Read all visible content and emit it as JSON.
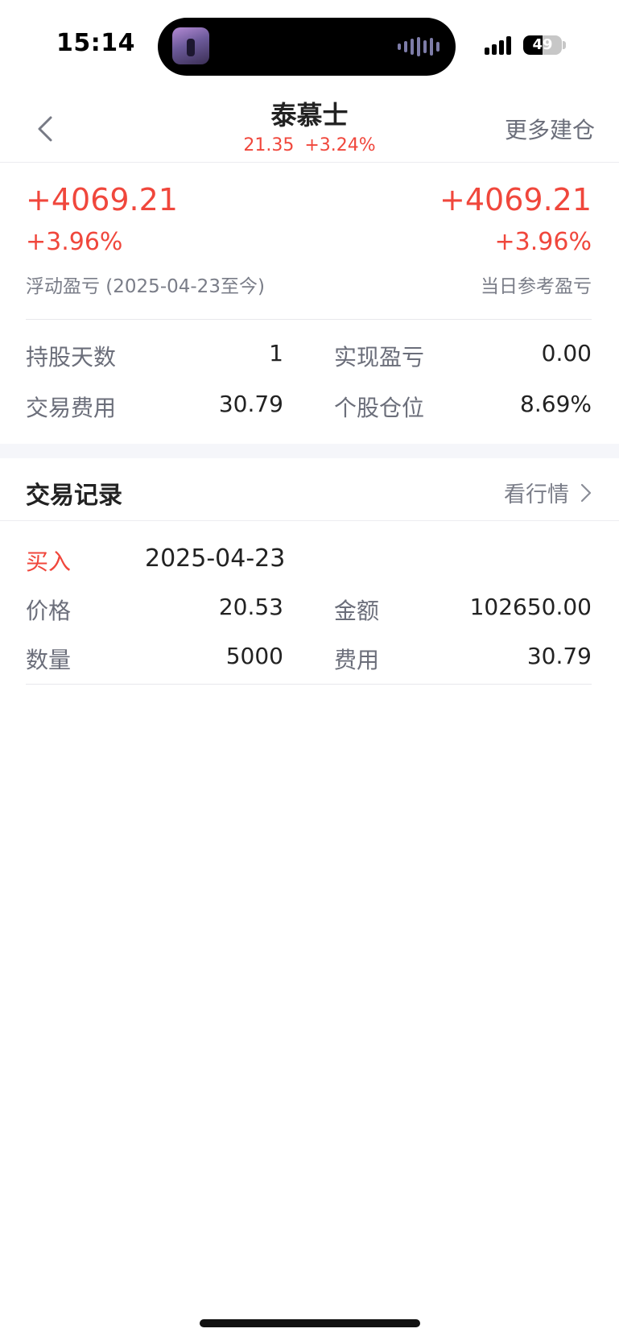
{
  "status_bar": {
    "time": "15:14",
    "battery": "49",
    "battery_level": 0.49,
    "island_icon": "music-artwork-thumbnail",
    "island_activity_icon": "audio-waveform-icon"
  },
  "nav": {
    "back_icon": "chevron-left-icon",
    "title": "泰慕士",
    "price": "21.35",
    "change_pct": "+3.24%",
    "more_label": "更多建仓"
  },
  "summary": {
    "floating": {
      "amount": "+4069.21",
      "pct": "+3.96%",
      "label": "浮动盈亏 (2025-04-23至今)"
    },
    "daily": {
      "amount": "+4069.21",
      "pct": "+3.96%",
      "label": "当日参考盈亏"
    },
    "stats": [
      {
        "label": "持股天数",
        "value": "1"
      },
      {
        "label": "实现盈亏",
        "value": "0.00"
      },
      {
        "label": "交易费用",
        "value": "30.79"
      },
      {
        "label": "个股仓位",
        "value": "8.69%"
      }
    ]
  },
  "records": {
    "title": "交易记录",
    "market_link": "看行情",
    "items": [
      {
        "type": "买入",
        "date": "2025-04-23",
        "fields": [
          {
            "label": "价格",
            "value": "20.53"
          },
          {
            "label": "金额",
            "value": "102650.00"
          },
          {
            "label": "数量",
            "value": "5000"
          },
          {
            "label": "费用",
            "value": "30.79"
          }
        ]
      }
    ]
  },
  "colors": {
    "up_red": "#f0473c",
    "label_grey": "#6b6e7a",
    "text_dark": "#222222",
    "band_bg": "#f5f6fa"
  }
}
